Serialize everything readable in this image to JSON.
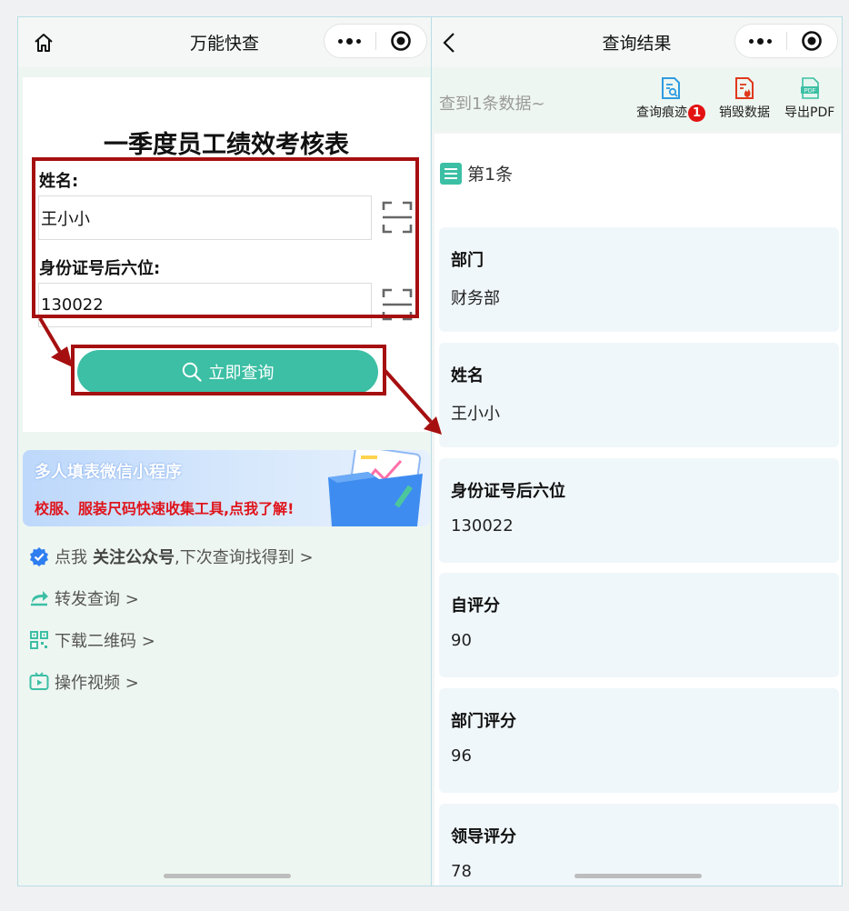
{
  "left_screen": {
    "nav_title": "万能快查",
    "form_title": "一季度员工绩效考核表",
    "fields": [
      {
        "label": "姓名:",
        "value": "王小小"
      },
      {
        "label": "身份证号后六位:",
        "value": "130022"
      }
    ],
    "query_button": "立即查询",
    "banner": {
      "title": "多人填表微信小程序",
      "subtitle": "校服、服装尺码快速收集工具,点我了解!"
    },
    "links": {
      "follow_prefix": "点我",
      "follow_bold": "关注公众号",
      "follow_suffix": ",下次查询找得到 >",
      "share": "转发查询 >",
      "qrcode": "下载二维码 >",
      "video": "操作视频 >"
    }
  },
  "right_screen": {
    "nav_title": "查询结果",
    "summary": "查到1条数据~",
    "tools": {
      "trace": "查询痕迹",
      "trace_badge": "1",
      "destroy": "销毁数据",
      "export": "导出PDF"
    },
    "record_header": "第1条",
    "items": [
      {
        "label": "部门",
        "value": "财务部"
      },
      {
        "label": "姓名",
        "value": "王小小"
      },
      {
        "label": "身份证号后六位",
        "value": "130022"
      },
      {
        "label": "自评分",
        "value": "90"
      },
      {
        "label": "部门评分",
        "value": "96"
      },
      {
        "label": "领导评分",
        "value": "78"
      }
    ]
  },
  "colors": {
    "accent": "#3cbfa4",
    "annotation_red": "#a60f10",
    "banner_red": "#e0141b",
    "badge_red": "#e31212"
  }
}
